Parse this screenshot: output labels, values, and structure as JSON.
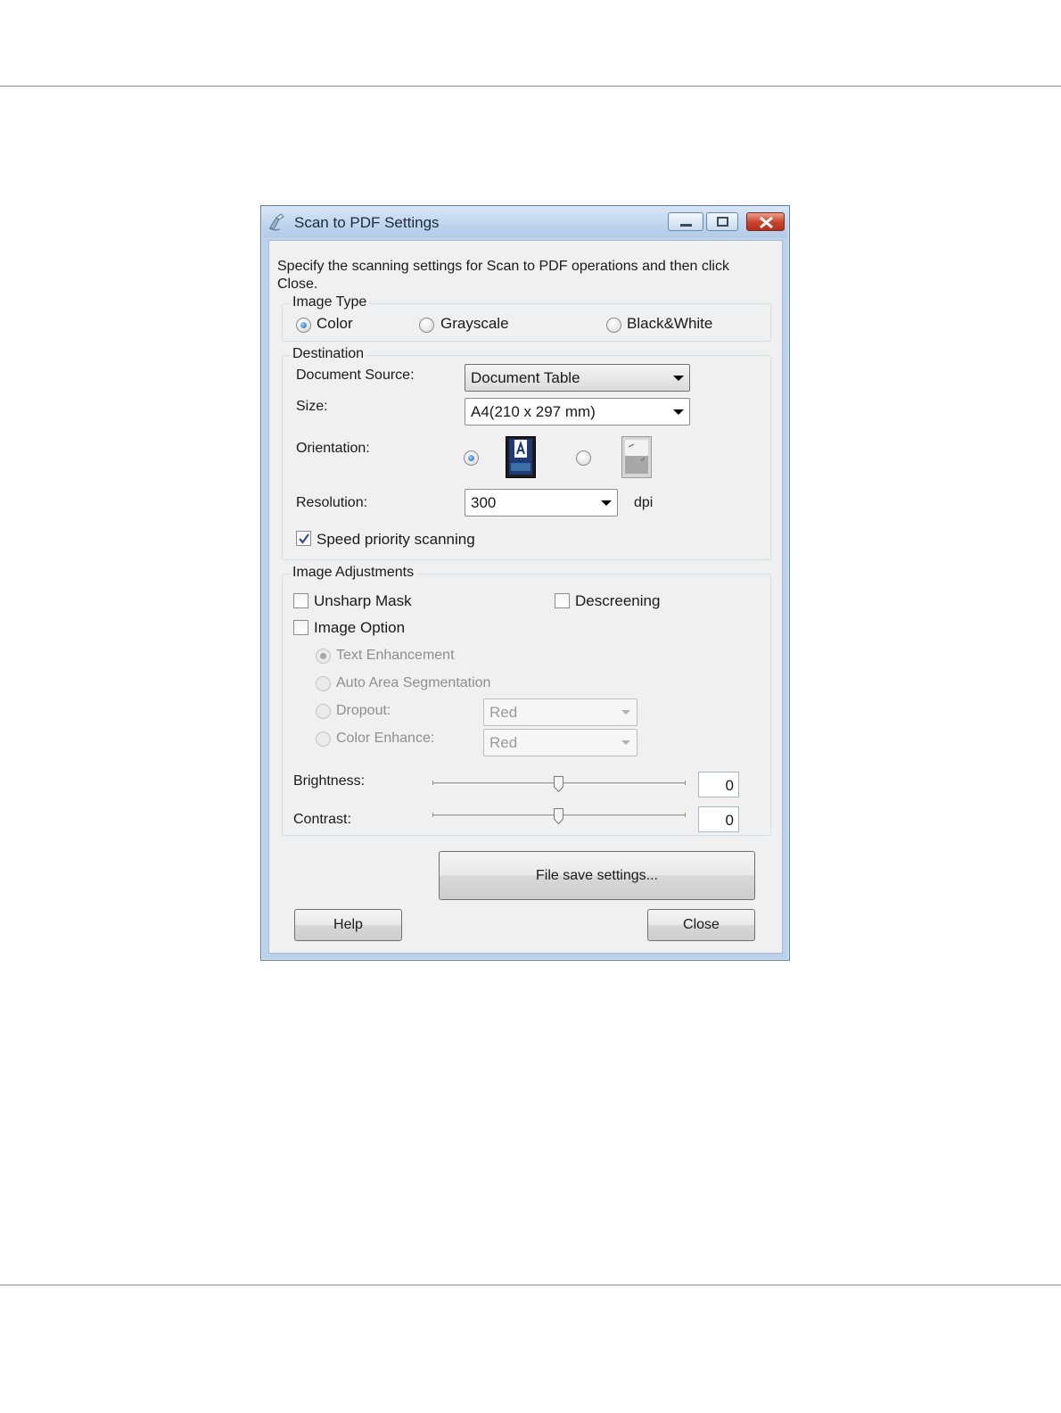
{
  "window": {
    "title": "Scan to PDF Settings"
  },
  "instructions": "Specify the scanning settings for Scan to PDF operations and then click Close.",
  "instructions_line1": "Specify the scanning settings for Scan to PDF operations and then click",
  "instructions_line2": "Close.",
  "image_type": {
    "label": "Image Type",
    "options": [
      "Color",
      "Grayscale",
      "Black&White"
    ],
    "selected": "Color"
  },
  "destination": {
    "label": "Destination",
    "document_source_label": "Document Source:",
    "document_source_value": "Document Table",
    "size_label": "Size:",
    "size_value": "A4(210 x 297 mm)",
    "orientation_label": "Orientation:",
    "orientation_selected": "portrait",
    "resolution_label": "Resolution:",
    "resolution_value": "300",
    "resolution_unit": "dpi",
    "speed_priority_label": "Speed priority scanning",
    "speed_priority_checked": true
  },
  "image_adjustments": {
    "label": "Image Adjustments",
    "unsharp_mask_label": "Unsharp Mask",
    "unsharp_mask_checked": false,
    "descreening_label": "Descreening",
    "descreening_checked": false,
    "image_option_label": "Image Option",
    "image_option_checked": false,
    "text_enhancement_label": "Text Enhancement",
    "auto_area_segmentation_label": "Auto Area Segmentation",
    "dropout_label": "Dropout:",
    "dropout_value": "Red",
    "color_enhance_label": "Color Enhance:",
    "color_enhance_value": "Red",
    "brightness_label": "Brightness:",
    "brightness_value": "0",
    "contrast_label": "Contrast:",
    "contrast_value": "0"
  },
  "buttons": {
    "file_save_settings": "File save settings...",
    "help": "Help",
    "close": "Close"
  },
  "colors": {
    "titlebar": "#bfd5ee",
    "dialog_background": "#f0f0f0",
    "close_button": "#c8422a",
    "disabled_text": "#8f8f8f"
  }
}
